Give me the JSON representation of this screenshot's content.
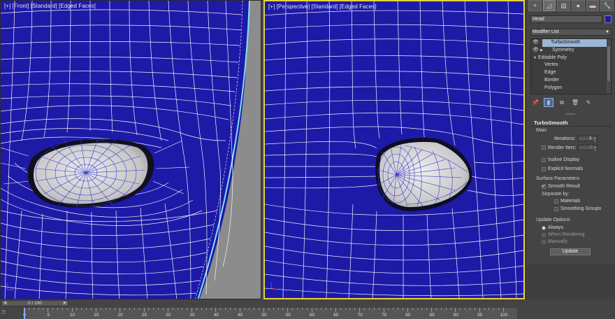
{
  "viewports": {
    "front": {
      "label": "[+] [Front] [Standard] [Edged Faces]"
    },
    "perspective": {
      "label": "[+] [Perspective] [Standard] [Edged Faces]"
    }
  },
  "command_panel": {
    "tabs": [
      {
        "name": "create-tab-icon",
        "glyph": "+"
      },
      {
        "name": "modify-tab-icon",
        "glyph": "◿"
      },
      {
        "name": "hierarchy-tab-icon",
        "glyph": "▤"
      },
      {
        "name": "motion-tab-icon",
        "glyph": "●"
      },
      {
        "name": "display-tab-icon",
        "glyph": "▬"
      },
      {
        "name": "utilities-tab-icon",
        "glyph": "🔧"
      }
    ],
    "object_name": "Head",
    "object_color": "#1d1aa8",
    "modifier_list_label": "Modifier List",
    "stack": {
      "turbosmooth": "TurboSmooth",
      "symmetry": "Symmetry",
      "editable_poly": "Editable Poly",
      "vertex": "Vertex",
      "edge": "Edge",
      "border": "Border",
      "polygon": "Polygon"
    },
    "turbosmooth": {
      "title": "TurboSmooth",
      "main_label": "Main",
      "iterations_label": "Iterations:",
      "iterations_value": "1",
      "render_iters_label": "Render Iters:",
      "render_iters_value": "0",
      "isoline_label": "Isoline Display",
      "explicit_normals_label": "Explicit Normals",
      "surface_params_label": "Surface Parameters",
      "smooth_result_label": "Smooth Result",
      "separate_by_label": "Separate by:",
      "materials_label": "Materials",
      "smoothing_groups_label": "Smoothing Groups",
      "update_options_label": "Update Options",
      "always_label": "Always",
      "when_rendering_label": "When Rendering",
      "manually_label": "Manually",
      "update_button": "Update"
    }
  },
  "timeline": {
    "slider_text": "0 / 100",
    "tick_labels": [
      "0",
      "5",
      "10",
      "15",
      "20",
      "25",
      "30",
      "35",
      "40",
      "45",
      "50",
      "55",
      "60",
      "65",
      "70",
      "75",
      "80",
      "85",
      "90",
      "95",
      "100"
    ]
  },
  "colors": {
    "viewport_bg": "#1d1aa8",
    "wire": "#ffffff",
    "active_border": "#e6d23a",
    "selection": "#9cb6d6"
  }
}
